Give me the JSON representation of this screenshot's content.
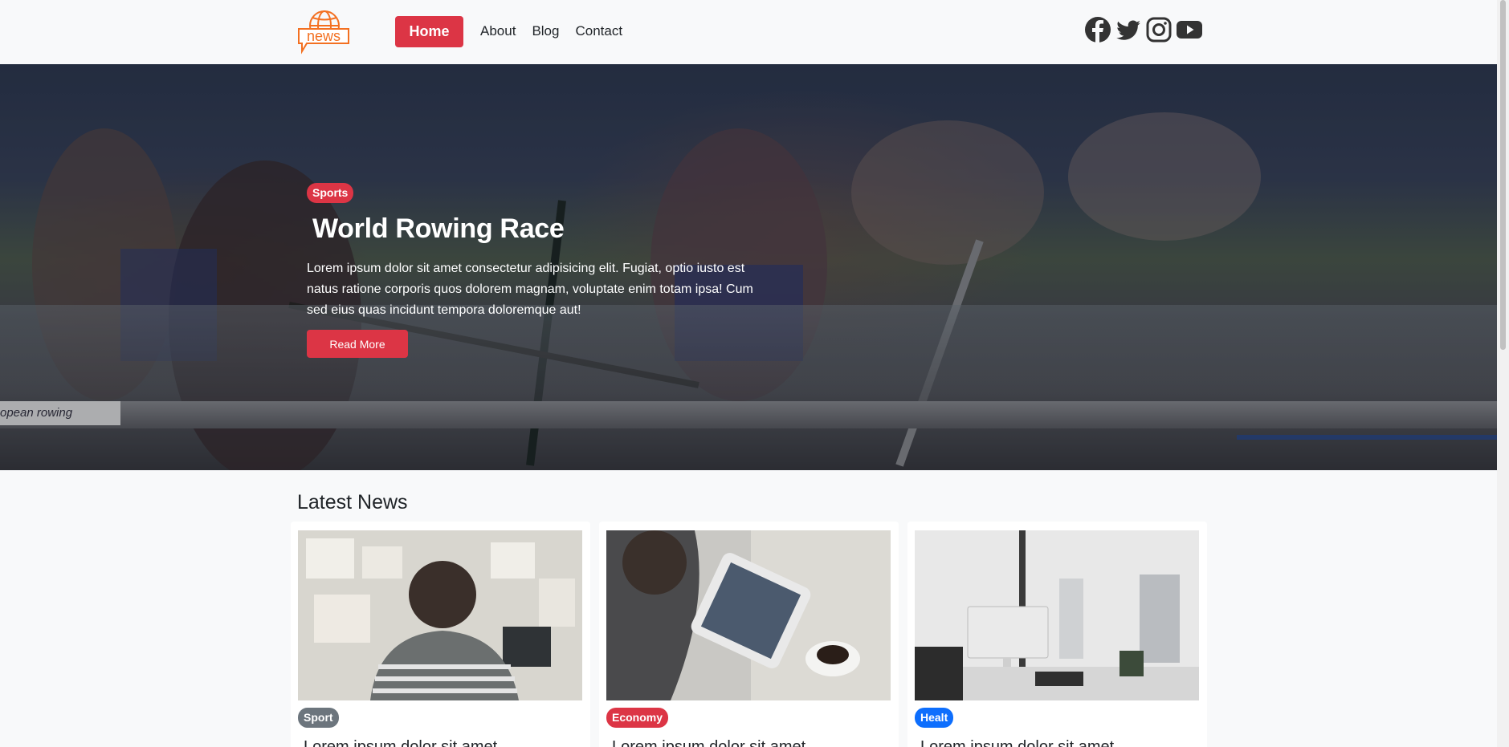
{
  "navbar": {
    "logo_text": "news",
    "links": [
      {
        "label": "Home",
        "active": true
      },
      {
        "label": "About"
      },
      {
        "label": "Blog"
      },
      {
        "label": "Contact"
      }
    ],
    "social_icons": [
      "facebook-icon",
      "twitter-icon",
      "instagram-icon",
      "youtube-icon"
    ]
  },
  "hero": {
    "badge": "Sports",
    "title": "World Rowing Race",
    "text": "Lorem ipsum dolor sit amet consectetur adipisicing elit. Fugiat, optio iusto est natus ratione corporis quos dolorem magnam, voluptate enim totam ipsa! Cum sed eius quas incidunt tempora doloremque aut!",
    "button": "Read More",
    "sign_text": "opean rowing"
  },
  "latest": {
    "title": "Latest News",
    "cards": [
      {
        "badge": "Sport",
        "badge_color": "#6c757d",
        "title": "Lorem ipsum dolor sit amet"
      },
      {
        "badge": "Economy",
        "badge_color": "#dc3545",
        "title": "Lorem ipsum dolor sit amet"
      },
      {
        "badge": "Healt",
        "badge_color": "#0d6efd",
        "title": "Lorem ipsum dolor sit amet"
      }
    ]
  },
  "colors": {
    "accent": "#dc3545",
    "logo": "#f37021",
    "background": "#f8f9fa"
  }
}
